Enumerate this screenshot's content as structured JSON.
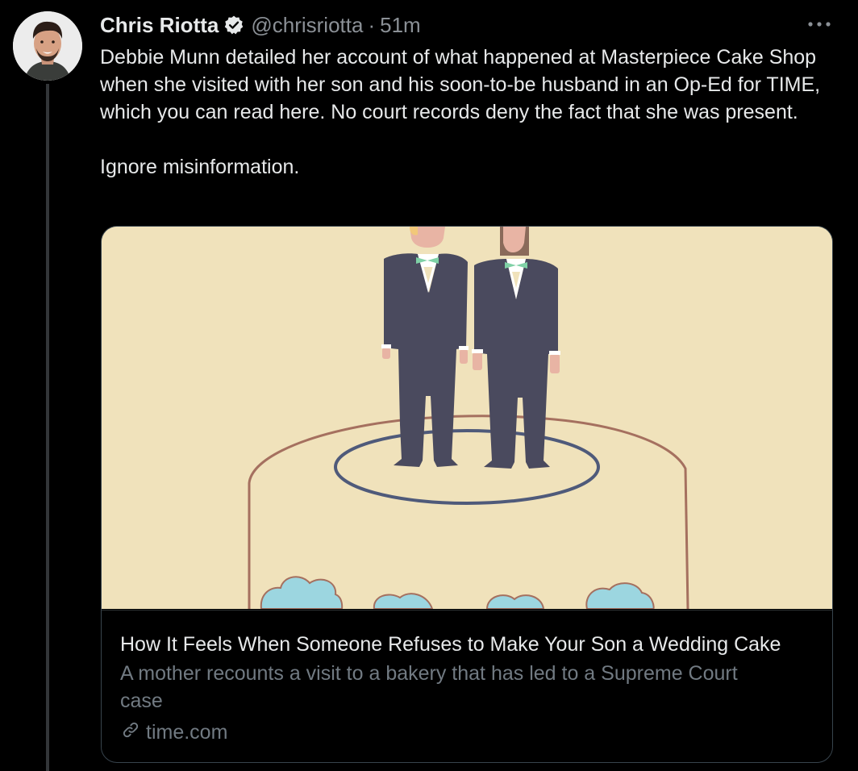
{
  "tweet": {
    "author_name": "Chris Riotta",
    "handle": "@chrisriotta",
    "separator": "·",
    "time": "51m",
    "text_paragraph_1": "Debbie Munn detailed her account of what happened at Masterpiece Cake Shop when she visited with her son and his soon-to-be husband in an Op-Ed for TIME, which you can read here. No court records deny the fact that she was present.",
    "text_paragraph_2": "Ignore misinformation."
  },
  "card": {
    "title": "How It Feels When Someone Refuses to Make Your Son a Wedding Cake",
    "description": "A mother recounts a visit to a bakery that has led to a Supreme Court case",
    "domain": "time.com",
    "domain_icon": "link-icon",
    "image_subject": "two grooms cake topper illustration"
  },
  "icons": {
    "verified": "verified-badge-icon",
    "more": "more-options-icon"
  },
  "colors": {
    "background": "#000000",
    "text_primary": "#e7e9ea",
    "text_secondary": "#8b9096",
    "card_border": "#38444d",
    "illustration_bg": "#f0e2bb",
    "suit": "#4a4a5e",
    "bowtie": "#7fd1a6",
    "frosting": "#9cd6e0"
  }
}
